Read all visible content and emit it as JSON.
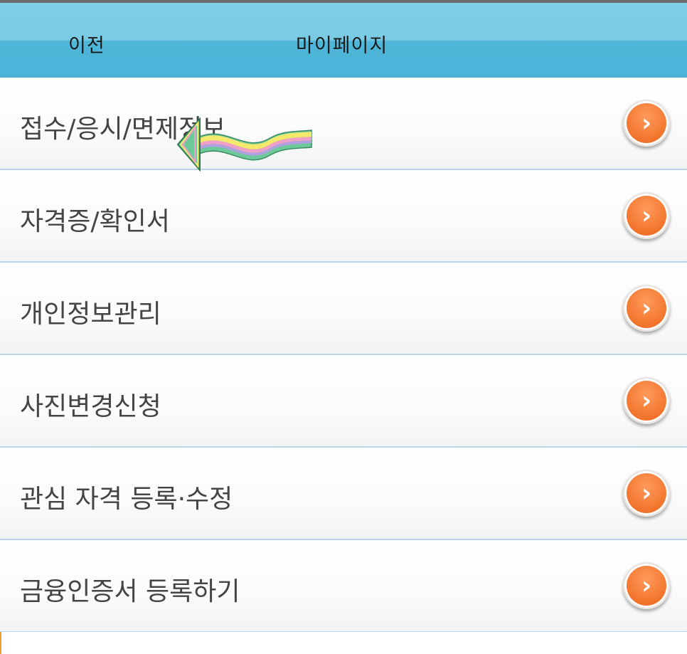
{
  "header": {
    "back_label": "이전",
    "title": "마이페이지"
  },
  "menu": {
    "items": [
      {
        "label": "접수/응시/면제정보",
        "icon": "chevron-right-icon"
      },
      {
        "label": "자격증/확인서",
        "icon": "chevron-right-icon"
      },
      {
        "label": "개인정보관리",
        "icon": "chevron-right-icon"
      },
      {
        "label": "사진변경신청",
        "icon": "chevron-right-icon"
      },
      {
        "label": "관심 자격 등록·수정",
        "icon": "chevron-right-icon"
      },
      {
        "label": "금융인증서 등록하기",
        "icon": "chevron-right-icon"
      }
    ]
  },
  "colors": {
    "header_top": "#7fcfe6",
    "header_bottom": "#4ab3d7",
    "accent_orange": "#f47a32",
    "divider": "#b8d6ea"
  }
}
